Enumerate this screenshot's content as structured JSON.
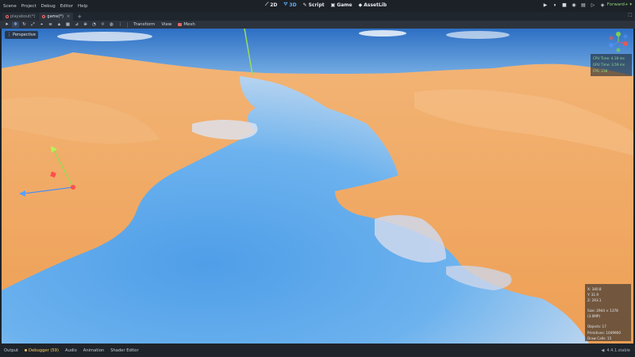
{
  "menu": [
    "Scene",
    "Project",
    "Debug",
    "Editor",
    "Help"
  ],
  "modes": [
    {
      "label": "2D",
      "icon": "2d-icon",
      "active": false
    },
    {
      "label": "3D",
      "icon": "3d-icon",
      "active": true
    },
    {
      "label": "Script",
      "icon": "script-icon",
      "active": false
    },
    {
      "label": "Game",
      "icon": "game-icon",
      "active": false
    },
    {
      "label": "AssetLib",
      "icon": "assetlib-icon",
      "active": false
    }
  ],
  "renderer": "Forward+",
  "scene_tabs": [
    {
      "label": "playabout(*)",
      "active": false
    },
    {
      "label": "game(*)",
      "active": true
    }
  ],
  "toolbar": {
    "transform_label": "Transform",
    "view_label": "View",
    "mesh_label": "Mesh"
  },
  "viewport": {
    "perspective_label": "Perspective",
    "perf": {
      "cpu": "CPU Time: 4.18 ms",
      "gpu": "GPU Time: 3.59 ms",
      "fps": "FPS: 238"
    },
    "info": {
      "x": "X: 340.8",
      "y": "Y: 31.9",
      "z": "Z: 293.1",
      "size": "Size: 2944 × 1378 (3.0MP)",
      "objects": "Objects: 17",
      "primitives": "Primitives: 1049900",
      "draw_calls": "Draw Calls: 15"
    }
  },
  "bottom_tabs": [
    "Output",
    "Debugger (59)",
    "Audio",
    "Animation",
    "Shader Editor"
  ],
  "version": "4.4.1.stable",
  "colors": {
    "sand": "#f0a860",
    "water": "#5aa6e6",
    "accent": "#5fb2ff",
    "warning": "#ffcf5c"
  }
}
